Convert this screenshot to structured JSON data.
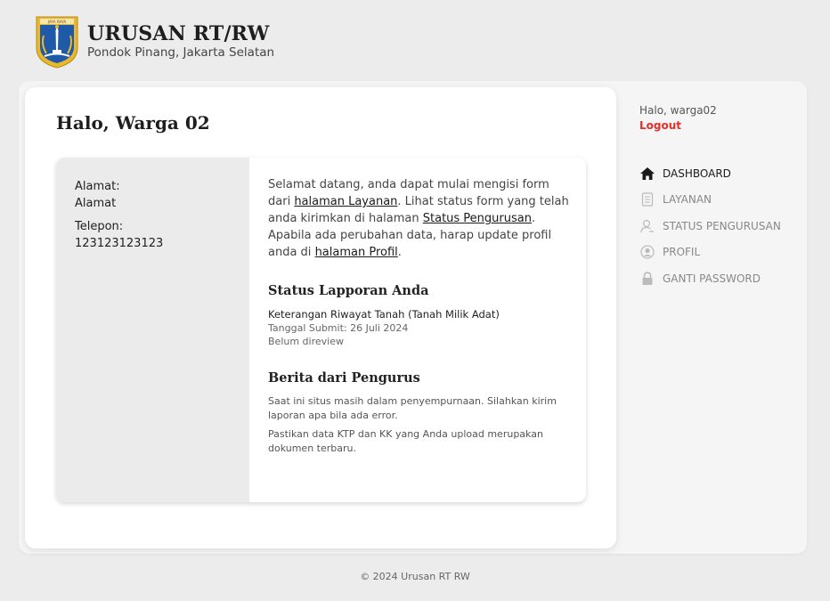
{
  "header": {
    "logo_text": "JAYA RAYA",
    "title": "URUSAN RT/RW",
    "subtitle": "Pondok Pinang, Jakarta Selatan"
  },
  "main": {
    "greeting": "Halo, Warga 02",
    "profile": {
      "address_label": "Alamat:",
      "address_value": "Alamat",
      "phone_label": "Telepon:",
      "phone_value": "123123123123"
    },
    "welcome": {
      "t1": "Selamat datang, anda dapat mulai mengisi form dari ",
      "link1": "halaman Layanan",
      "t2": ". Lihat status form yang telah anda kirimkan di halaman ",
      "link2": "Status Pengurusan",
      "t3": ". Apabila ada perubahan data, harap update profil anda di ",
      "link3": "halaman Profil",
      "t4": "."
    },
    "report": {
      "heading": "Status Lapporan Anda",
      "title": "Keterangan Riwayat Tanah (Tanah Milik Adat)",
      "date": "Tanggal Submit: 26 Juli 2024",
      "status": "Belum direview"
    },
    "news": {
      "heading": "Berita dari Pengurus",
      "items": [
        "Saat ini situs masih dalam penyempurnaan. Silahkan kirim laporan apa bila ada error.",
        "Pastikan data KTP dan KK yang Anda upload merupakan dokumen terbaru."
      ]
    }
  },
  "sidebar": {
    "hello": "Halo, warga02",
    "logout": "Logout",
    "items": [
      {
        "label": "DASHBOARD",
        "icon": "home-icon"
      },
      {
        "label": "LAYANAN",
        "icon": "document-icon"
      },
      {
        "label": "STATUS PENGURUSAN",
        "icon": "user-status-icon"
      },
      {
        "label": "PROFIL",
        "icon": "profile-icon"
      },
      {
        "label": "GANTI PASSWORD",
        "icon": "lock-icon"
      }
    ]
  },
  "footer": {
    "text": "© 2024 Urusan RT RW"
  },
  "colors": {
    "accent_red": "#e0302a",
    "logo_blue": "#1f5aa8",
    "logo_gold": "#e9b82c"
  }
}
